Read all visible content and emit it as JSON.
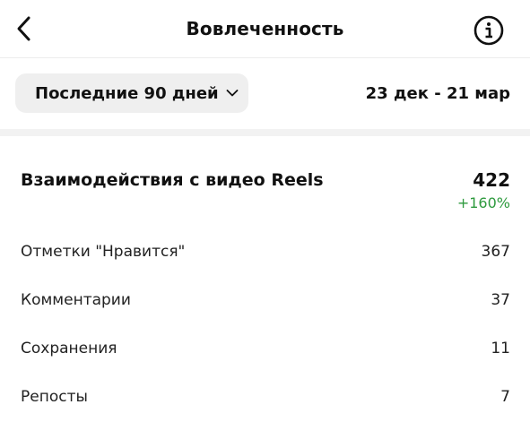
{
  "header": {
    "title": "Вовлеченность",
    "back_icon": "chevron-left-icon",
    "info_icon": "info-icon"
  },
  "filter": {
    "period_label": "Последние 90 дней",
    "date_range": "23 дек - 21 мар"
  },
  "reels": {
    "title": "Взаимодействия с видео Reels",
    "total": "422",
    "change": "+160%",
    "change_color": "#2e9a3e"
  },
  "metrics": [
    {
      "label": "Отметки \"Нравится\"",
      "value": "367"
    },
    {
      "label": "Комментарии",
      "value": "37"
    },
    {
      "label": "Сохранения",
      "value": "11"
    },
    {
      "label": "Репосты",
      "value": "7"
    }
  ]
}
